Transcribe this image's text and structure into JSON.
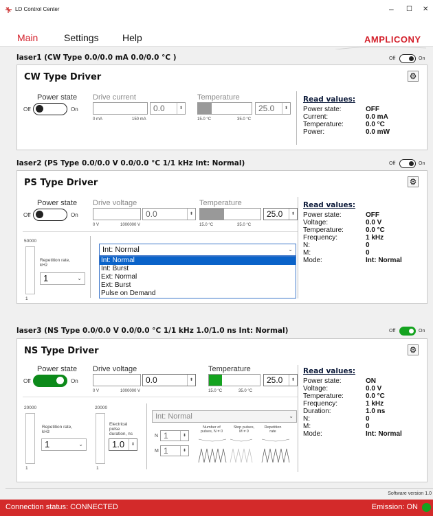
{
  "window": {
    "title": "LD Control Center",
    "minimize": "–",
    "maximize": "☐",
    "close": "✕"
  },
  "menu": {
    "main": "Main",
    "settings": "Settings",
    "help": "Help"
  },
  "brand": {
    "name": "AMPLICONY",
    "color": "#d31f2a"
  },
  "toggle_labels": {
    "off": "Off",
    "on": "On"
  },
  "lasers": [
    {
      "header": "laser1 (CW Type 0.0/0.0 mA  0.0/0.0 °C )",
      "title": "CW Type Driver",
      "power_state_label": "Power state",
      "power_on": false,
      "drive_label": "Drive current",
      "drive_value": "0.0",
      "drive_min": "0 mA",
      "drive_max": "150 mA",
      "temp_label": "Temperature",
      "temp_value": "25.0",
      "temp_min": "15.0 °C",
      "temp_max": "35.0 °C",
      "read_title": "Read values:",
      "reads": [
        {
          "k": "Power state:",
          "v": "OFF"
        },
        {
          "k": "Current:",
          "v": "0.0 mA"
        },
        {
          "k": "Temperature:",
          "v": "0.0 °C"
        },
        {
          "k": "Power:",
          "v": "0.0 mW"
        }
      ]
    },
    {
      "header": "laser2 (PS Type 0.0/0.0 V  0.0/0.0 °C  1/1 kHz  Int: Normal)",
      "title": "PS Type Driver",
      "power_state_label": "Power state",
      "power_on": false,
      "drive_label": "Drive voltage",
      "drive_value": "0.0",
      "drive_min": "0 V",
      "drive_max": "1000000 V",
      "temp_label": "Temperature",
      "temp_value": "25.0",
      "temp_min": "15.0 °C",
      "temp_max": "35.0 °C",
      "rep_top": "50000",
      "rep_bottom": "1",
      "rep_label": "Repetition rate, kHz",
      "rep_value": "1",
      "mode_value": "Int: Normal",
      "mode_options": [
        "Int: Normal",
        "Int: Burst",
        "Ext: Normal",
        "Ext: Burst",
        "Pulse on Demand"
      ],
      "read_title": "Read values:",
      "reads": [
        {
          "k": "Power state:",
          "v": "OFF"
        },
        {
          "k": "Voltage:",
          "v": "0.0 V"
        },
        {
          "k": "Temperature:",
          "v": "0.0 °C"
        },
        {
          "k": "Frequency:",
          "v": "1 kHz"
        },
        {
          "k": "N:",
          "v": "0"
        },
        {
          "k": "M:",
          "v": "0"
        },
        {
          "k": "Mode:",
          "v": "Int: Normal"
        }
      ]
    },
    {
      "header": "laser3 (NS Type 0.0/0.0 V  0.0/0.0 °C  1/1 kHz  1.0/1.0 ns  Int: Normal)",
      "title": "NS Type Driver",
      "power_state_label": "Power state",
      "power_on": true,
      "drive_label": "Drive voltage",
      "drive_value": "0.0",
      "drive_min": "0 V",
      "drive_max": "1000000 V",
      "temp_label": "Temperature",
      "temp_value": "25.0",
      "temp_min": "15.0 °C",
      "temp_max": "35.0 °C",
      "rep_top": "20000",
      "rep_bottom": "1",
      "rep_label": "Repetition rate, kHz",
      "rep_value": "1",
      "dur_top": "20000",
      "dur_bottom": "1",
      "dur_label": "Electrical pulse duration, ns",
      "dur_value": "1.0",
      "mode_value": "Int: Normal",
      "n_label": "N",
      "n_value": "1",
      "m_label": "M",
      "m_value": "1",
      "diag_num_label": "Number of pulses, N ≠ 0",
      "diag_stop_label": "Stop pulses, M ≠ 0",
      "diag_rep_label": "Repetition rate",
      "read_title": "Read values:",
      "reads": [
        {
          "k": "Power state:",
          "v": "ON"
        },
        {
          "k": "Voltage:",
          "v": "0.0 V"
        },
        {
          "k": "Temperature:",
          "v": "0.0 °C"
        },
        {
          "k": "Frequency:",
          "v": "1 kHz"
        },
        {
          "k": "Duration:",
          "v": "1.0 ns"
        },
        {
          "k": "N:",
          "v": "0"
        },
        {
          "k": "M:",
          "v": "0"
        },
        {
          "k": "Mode:",
          "v": "Int: Normal"
        }
      ]
    }
  ],
  "header_toggles": [
    false,
    false,
    true
  ],
  "software_version": "Software version 1.0",
  "status": {
    "connection": "Connection status: CONNECTED",
    "emission": "Emission: ON",
    "bar_color": "#d32a2a",
    "on_color": "#14a31f"
  }
}
